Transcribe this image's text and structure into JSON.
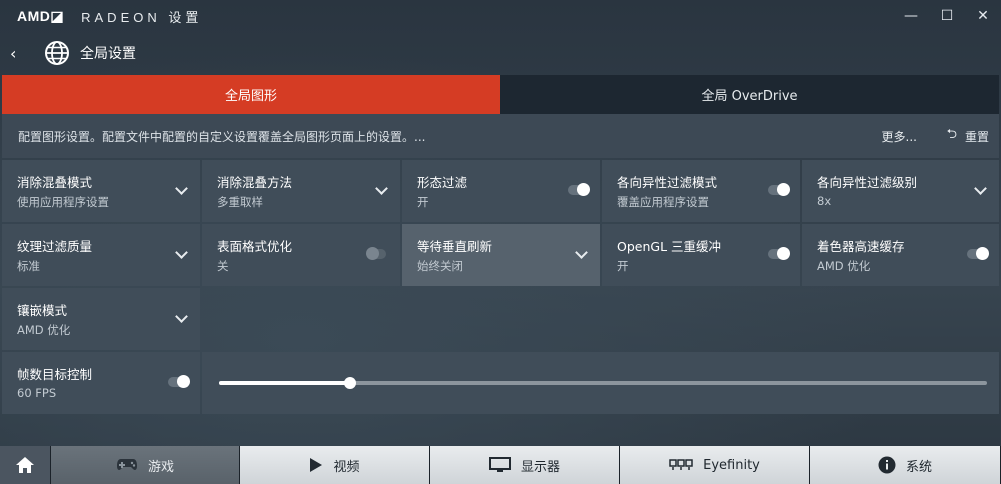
{
  "titlebar": {
    "brand": "AMD◪",
    "title": "RADEON 设置",
    "minimize": "—",
    "maximize": "☐",
    "close": "✕"
  },
  "header": {
    "back": "‹",
    "title": "全局设置",
    "icon": "globe-icon"
  },
  "tabs": [
    {
      "label": "全局图形",
      "active": true
    },
    {
      "label": "全局 OverDrive",
      "active": false
    }
  ],
  "info": {
    "text": "配置图形设置。配置文件中配置的自定义设置覆盖全局图形页面上的设置。...",
    "more": "更多...",
    "reset": "重置"
  },
  "settings": [
    {
      "label": "消除混叠模式",
      "value": "使用应用程序设置",
      "control": "dropdown"
    },
    {
      "label": "消除混叠方法",
      "value": "多重取样",
      "control": "dropdown"
    },
    {
      "label": "形态过滤",
      "value": "开",
      "control": "toggle-on"
    },
    {
      "label": "各向异性过滤模式",
      "value": "覆盖应用程序设置",
      "control": "toggle-on"
    },
    {
      "label": "各向异性过滤级别",
      "value": "8x",
      "control": "dropdown"
    },
    {
      "label": "纹理过滤质量",
      "value": "标准",
      "control": "dropdown"
    },
    {
      "label": "表面格式优化",
      "value": "关",
      "control": "toggle-off"
    },
    {
      "label": "等待垂直刷新",
      "value": "始终关闭",
      "control": "dropdown"
    },
    {
      "label": "OpenGL 三重缓冲",
      "value": "开",
      "control": "toggle-on"
    },
    {
      "label": "着色器高速缓存",
      "value": "AMD 优化",
      "control": "toggle-on"
    },
    {
      "label": "镶嵌模式",
      "value": "AMD 优化",
      "control": "dropdown"
    },
    {
      "label": "帧数目标控制",
      "value": "60 FPS",
      "control": "toggle-on"
    }
  ],
  "frame_target_slider": {
    "fraction": 0.17
  },
  "bottom_nav": [
    {
      "label": "游戏",
      "icon": "gamepad-icon"
    },
    {
      "label": "视频",
      "icon": "play-icon"
    },
    {
      "label": "显示器",
      "icon": "monitor-icon"
    },
    {
      "label": "Eyefinity",
      "icon": "eyefinity-icon"
    },
    {
      "label": "系统",
      "icon": "info-icon"
    }
  ],
  "colors": {
    "accent": "#d53c24"
  }
}
